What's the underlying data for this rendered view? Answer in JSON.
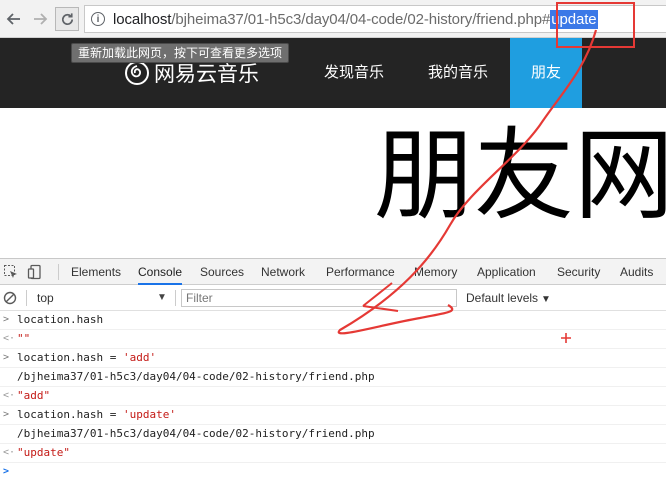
{
  "browser": {
    "url_prefix": "localhost",
    "url_path": "/bjheima37/01-h5c3/day04/04-code/02-history/friend.php#",
    "url_selected": "update",
    "tooltip": "重新加载此网页，按下可查看更多选项"
  },
  "site": {
    "logo_text": "网易云音乐",
    "nav": [
      {
        "label": "发现音乐"
      },
      {
        "label": "我的音乐"
      },
      {
        "label": "朋友"
      }
    ],
    "big_title": "朋友网"
  },
  "devtools": {
    "tabs": [
      "Elements",
      "Console",
      "Sources",
      "Network",
      "Performance",
      "Memory",
      "Application",
      "Security",
      "Audits"
    ],
    "active_tab": "Console",
    "context": "top",
    "filter_placeholder": "Filter",
    "levels": "Default levels",
    "console_lines": [
      {
        "kind": "input",
        "text": "location.hash"
      },
      {
        "kind": "result",
        "text": "\"\""
      },
      {
        "kind": "input",
        "code": "location.hash = ",
        "str": "'add'"
      },
      {
        "kind": "log",
        "text": "/bjheima37/01-h5c3/day04/04-code/02-history/friend.php"
      },
      {
        "kind": "result",
        "text": "\"add\""
      },
      {
        "kind": "input",
        "code": "location.hash = ",
        "str": "'update'"
      },
      {
        "kind": "log",
        "text": "/bjheima37/01-h5c3/day04/04-code/02-history/friend.php"
      },
      {
        "kind": "result",
        "text": "\"update\""
      }
    ]
  },
  "colors": {
    "header_bg": "#242424",
    "active_nav": "#1f9ee0",
    "url_selection": "#3b78e7",
    "annotation": "#e53935"
  }
}
